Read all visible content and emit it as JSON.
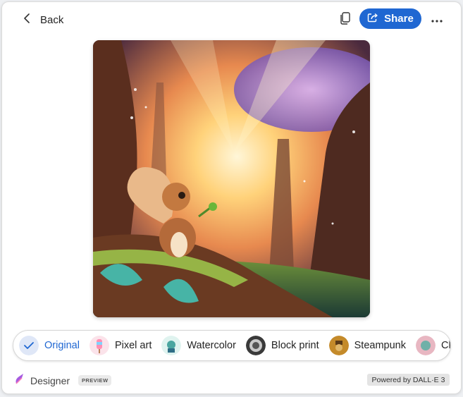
{
  "header": {
    "back_label": "Back",
    "share_label": "Share"
  },
  "colors": {
    "accent": "#1f67d2",
    "panel_bg": "#ffffff",
    "page_bg": "#eef0f3"
  },
  "icons": [
    "chevron-left-icon",
    "copy-icon",
    "share-icon",
    "more-icon",
    "check-icon",
    "designer-logo-icon"
  ],
  "image": {
    "description_visible": "squirrel-in-forest-illustration"
  },
  "styles": {
    "items": [
      {
        "label": "Original",
        "selected": true
      },
      {
        "label": "Pixel art",
        "selected": false
      },
      {
        "label": "Watercolor",
        "selected": false
      },
      {
        "label": "Block print",
        "selected": false
      },
      {
        "label": "Steampunk",
        "selected": false
      },
      {
        "label": "Cla",
        "selected": false
      }
    ]
  },
  "footer": {
    "app_name": "Designer",
    "preview_badge": "PREVIEW",
    "powered_by": "Powered by DALL·E 3"
  }
}
